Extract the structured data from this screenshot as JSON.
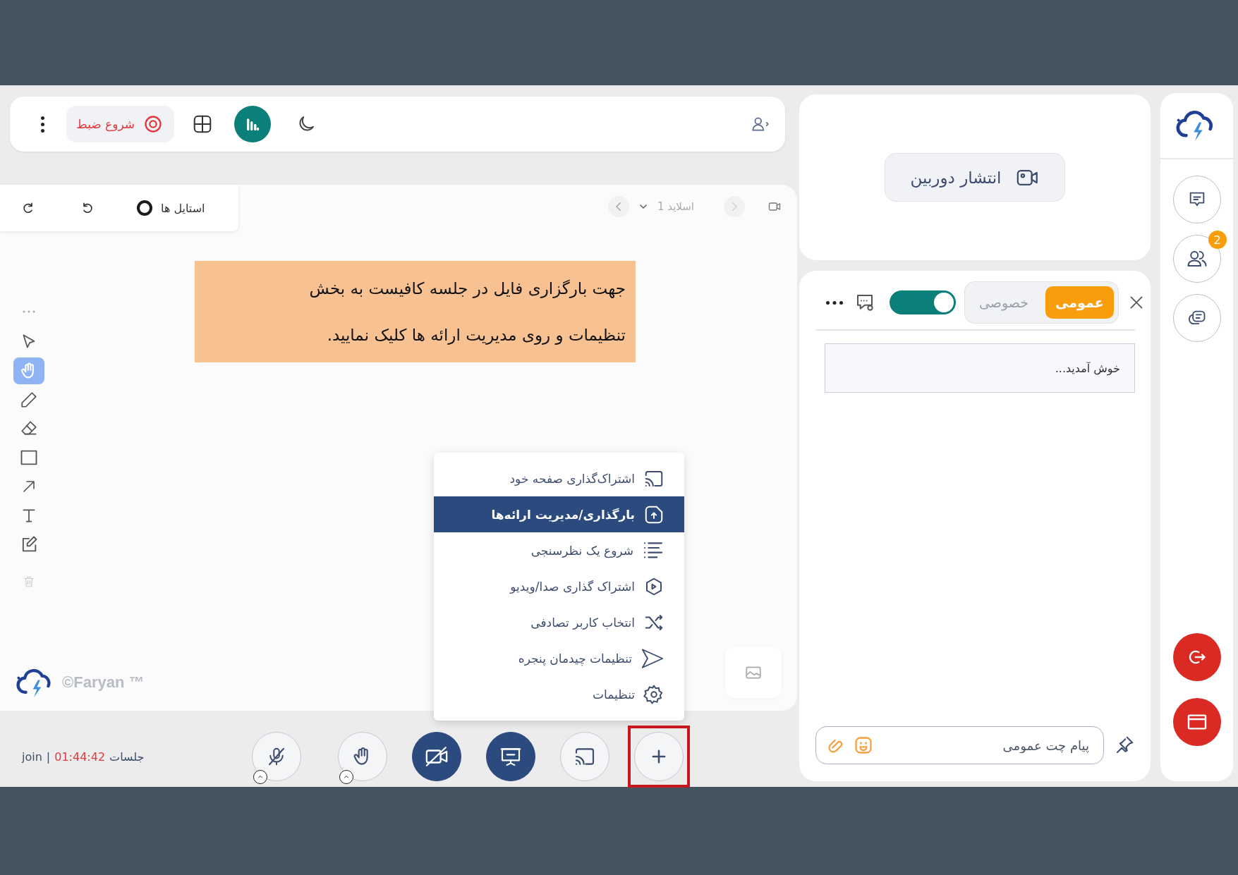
{
  "top_bar": {
    "record_label": "شروع ضبط"
  },
  "whiteboard": {
    "styles_label": "استایل ها",
    "slide_label": "اسلاید 1",
    "tools": [
      {
        "kind": "select",
        "selected": false
      },
      {
        "kind": "hand",
        "selected": true
      },
      {
        "kind": "pencil",
        "selected": false
      },
      {
        "kind": "eraser",
        "selected": false
      },
      {
        "kind": "rectangle",
        "selected": false
      },
      {
        "kind": "arrow",
        "selected": false
      },
      {
        "kind": "text",
        "selected": false
      },
      {
        "kind": "note",
        "selected": false
      }
    ],
    "note": "جهت بارگزاری فایل در جلسه کافیست به بخش تنظیمات و روی مدیریت ارائه ها کلیک نمایید.",
    "brand": "©Faryan ™"
  },
  "menu": {
    "items": [
      {
        "kind": "cast",
        "label": "اشتراک‌گذاری صفحه خود",
        "selected": false
      },
      {
        "kind": "upload",
        "label": "بارگذاری/مدیریت ارائه‌ها",
        "selected": true
      },
      {
        "kind": "poll",
        "label": "شروع یک نظرسنجی",
        "selected": false
      },
      {
        "kind": "media",
        "label": "اشتراک گذاری صدا/ویدیو",
        "selected": false
      },
      {
        "kind": "shuffle",
        "label": "انتخاب کاربر تصادفی",
        "selected": false
      },
      {
        "kind": "layout",
        "label": "تنظیمات چیدمان پنجره",
        "selected": false
      },
      {
        "kind": "settings",
        "label": "تنظیمات",
        "selected": false
      }
    ]
  },
  "bottom_bar": {
    "user": "join",
    "separator": "|",
    "timer": "01:44:42",
    "session_label": "جلسات",
    "controls": [
      {
        "kind": "mic",
        "active": false,
        "highlighted": false
      },
      {
        "kind": "hand",
        "active": false,
        "highlighted": false
      },
      {
        "kind": "camera",
        "active": true,
        "highlighted": false
      },
      {
        "kind": "present",
        "active": true,
        "highlighted": false
      },
      {
        "kind": "cast",
        "active": false,
        "highlighted": false
      },
      {
        "kind": "add",
        "active": false,
        "highlighted": true
      }
    ]
  },
  "camera_panel": {
    "publish_label": "انتشار دوربین"
  },
  "chat": {
    "tabs": [
      {
        "label": "عمومی",
        "selected": true
      },
      {
        "label": "خصوصی",
        "selected": false
      }
    ],
    "toggle_on": true,
    "messages": [
      "خوش آمدید..."
    ],
    "input_placeholder": "پیام چت عمومی"
  },
  "sidebar": {
    "users_badge": "2"
  }
}
